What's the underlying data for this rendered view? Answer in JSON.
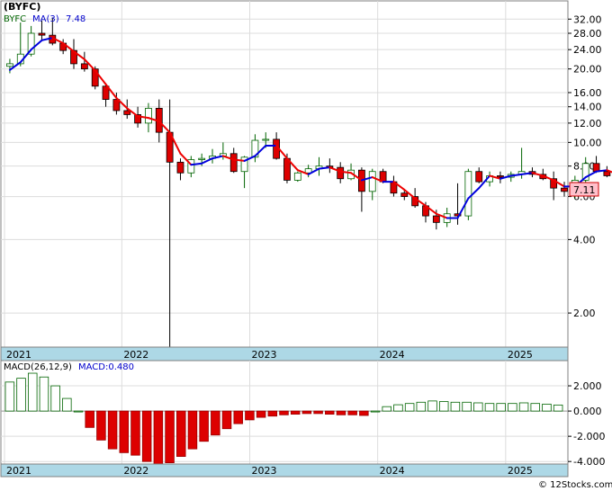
{
  "chart_data": [
    {
      "type": "candlestick",
      "title": "(BYFC)",
      "legend": {
        "symbol": "BYFC",
        "ma_label": "MA(3)",
        "ma_value": "7.48",
        "symbol_color": "#006400",
        "ma_color": "#0000cc"
      },
      "last_price_label": "7.11",
      "y_scale": "log",
      "ylim": [
        1.45,
        38.0
      ],
      "y_ticks": [
        "32.00",
        "28.00",
        "24.00",
        "20.00",
        "16.00",
        "14.00",
        "12.00",
        "10.00",
        "8.00",
        "6.00",
        "4.00",
        "2.00"
      ],
      "x_ticks": [
        {
          "label": "2021",
          "month": 0
        },
        {
          "label": "2022",
          "month": 11.0
        },
        {
          "label": "2023",
          "month": 23.0
        },
        {
          "label": "2024",
          "month": 35.0
        },
        {
          "label": "2025",
          "month": 47.0
        }
      ],
      "x_range_months": [
        0,
        52.5
      ],
      "colors": {
        "up": "#ffffff",
        "up_border": "#006400",
        "down": "#dd0000",
        "ma_up": "#0000dd",
        "ma_down": "#ee0000",
        "axis_band": "#add8e6"
      },
      "candles": [
        [
          20.5,
          22.0,
          19.2,
          21.0
        ],
        [
          21.0,
          31.0,
          20.5,
          23.0
        ],
        [
          23.0,
          30.0,
          22.5,
          28.0
        ],
        [
          28.0,
          31.5,
          26.0,
          27.5
        ],
        [
          27.5,
          32.5,
          25.0,
          25.5
        ],
        [
          25.5,
          26.5,
          23.0,
          23.8
        ],
        [
          23.8,
          26.5,
          20.0,
          21.0
        ],
        [
          21.0,
          23.5,
          19.5,
          20.0
        ],
        [
          20.0,
          20.5,
          16.5,
          17.0
        ],
        [
          17.0,
          17.5,
          14.0,
          15.0
        ],
        [
          15.0,
          16.0,
          13.0,
          13.5
        ],
        [
          13.5,
          15.0,
          12.5,
          13.0
        ],
        [
          13.0,
          14.0,
          11.5,
          12.0
        ],
        [
          12.0,
          14.5,
          11.0,
          13.8
        ],
        [
          13.8,
          15.0,
          10.0,
          11.0
        ],
        [
          11.0,
          15.0,
          1.45,
          8.3
        ],
        [
          8.3,
          8.6,
          7.0,
          7.5
        ],
        [
          7.5,
          8.8,
          7.2,
          8.5
        ],
        [
          8.5,
          9.0,
          8.0,
          8.6
        ],
        [
          8.6,
          9.4,
          8.2,
          8.8
        ],
        [
          8.8,
          10.0,
          8.5,
          9.0
        ],
        [
          9.0,
          9.5,
          7.5,
          7.6
        ],
        [
          7.6,
          8.8,
          6.5,
          8.7
        ],
        [
          8.7,
          10.8,
          8.3,
          10.2
        ],
        [
          10.2,
          11.0,
          9.5,
          10.3
        ],
        [
          10.3,
          11.0,
          8.5,
          8.6
        ],
        [
          8.6,
          9.0,
          6.8,
          7.0
        ],
        [
          7.0,
          7.6,
          6.9,
          7.5
        ],
        [
          7.5,
          8.1,
          7.2,
          7.8
        ],
        [
          7.8,
          8.7,
          7.3,
          8.0
        ],
        [
          8.0,
          8.6,
          7.5,
          7.9
        ],
        [
          7.9,
          8.3,
          6.8,
          7.1
        ],
        [
          7.1,
          8.2,
          7.0,
          7.7
        ],
        [
          7.7,
          7.9,
          5.2,
          6.3
        ],
        [
          6.3,
          7.8,
          5.8,
          7.6
        ],
        [
          7.6,
          7.8,
          6.8,
          6.9
        ],
        [
          6.9,
          7.3,
          6.0,
          6.2
        ],
        [
          6.2,
          6.4,
          5.8,
          6.0
        ],
        [
          6.0,
          6.5,
          5.4,
          5.5
        ],
        [
          5.5,
          5.7,
          4.7,
          5.0
        ],
        [
          5.0,
          5.3,
          4.4,
          4.7
        ],
        [
          4.7,
          5.4,
          4.5,
          5.1
        ],
        [
          5.1,
          6.8,
          4.6,
          5.0
        ],
        [
          5.0,
          7.8,
          4.8,
          7.6
        ],
        [
          7.6,
          7.9,
          6.8,
          6.9
        ],
        [
          6.9,
          7.6,
          6.6,
          7.3
        ],
        [
          7.3,
          7.6,
          6.8,
          7.2
        ],
        [
          7.2,
          7.6,
          6.9,
          7.4
        ],
        [
          7.4,
          9.5,
          7.1,
          7.6
        ],
        [
          7.6,
          7.9,
          7.2,
          7.4
        ],
        [
          7.4,
          7.8,
          7.0,
          7.1
        ],
        [
          7.1,
          7.6,
          5.8,
          6.5
        ],
        [
          6.5,
          6.9,
          6.0,
          6.3
        ],
        [
          6.3,
          7.3,
          5.9,
          7.0
        ],
        [
          7.0,
          8.7,
          6.8,
          8.2
        ],
        [
          8.2,
          8.8,
          7.5,
          7.6
        ],
        [
          7.6,
          8.0,
          7.2,
          7.3
        ],
        [
          7.3,
          7.6,
          7.0,
          7.11
        ]
      ],
      "ma": [
        19.8,
        21.3,
        24.0,
        26.2,
        26.8,
        25.5,
        23.6,
        21.9,
        19.7,
        17.3,
        15.2,
        13.8,
        12.8,
        12.6,
        12.2,
        11.0,
        9.0,
        8.1,
        8.2,
        8.6,
        8.8,
        8.5,
        8.4,
        8.8,
        9.7,
        9.7,
        8.6,
        7.7,
        7.4,
        7.8,
        7.9,
        7.6,
        7.5,
        7.0,
        7.2,
        6.9,
        6.9,
        6.4,
        5.9,
        5.5,
        5.1,
        4.9,
        4.9,
        5.9,
        6.5,
        7.3,
        7.1,
        7.3,
        7.4,
        7.5,
        7.3,
        7.0,
        6.6,
        6.6,
        7.2,
        7.6,
        7.7,
        7.4
      ],
      "y2_label": ""
    },
    {
      "type": "bar",
      "title": "MACD",
      "legend": {
        "label": "MACD(26,12,9)",
        "value_label": "MACD:0.480",
        "value_color": "#0000cc"
      },
      "ylim": [
        -4.2,
        4.0
      ],
      "y_ticks": [
        "2.000",
        "0.000",
        "-2.000",
        "-4.000"
      ],
      "y_tick_values": [
        2.0,
        0.0,
        -2.0,
        -4.0
      ],
      "x_ticks": [
        "2021",
        "2022",
        "2023",
        "2024",
        "2025"
      ],
      "colors": {
        "positive": "#006400",
        "negative": "#dd0000"
      },
      "values": [
        2.3,
        2.6,
        3.0,
        2.7,
        2.0,
        1.0,
        0.0,
        -1.3,
        -2.3,
        -3.0,
        -3.3,
        -3.5,
        -4.0,
        -4.2,
        -4.1,
        -3.6,
        -3.0,
        -2.4,
        -1.9,
        -1.4,
        -1.0,
        -0.7,
        -0.5,
        -0.4,
        -0.3,
        -0.25,
        -0.2,
        -0.2,
        -0.25,
        -0.3,
        -0.3,
        -0.35,
        0.0,
        0.35,
        0.5,
        0.6,
        0.7,
        0.8,
        0.75,
        0.7,
        0.7,
        0.65,
        0.6,
        0.6,
        0.6,
        0.65,
        0.6,
        0.55,
        0.48
      ]
    }
  ],
  "footer": {
    "copyright": "© 12Stocks.com"
  }
}
